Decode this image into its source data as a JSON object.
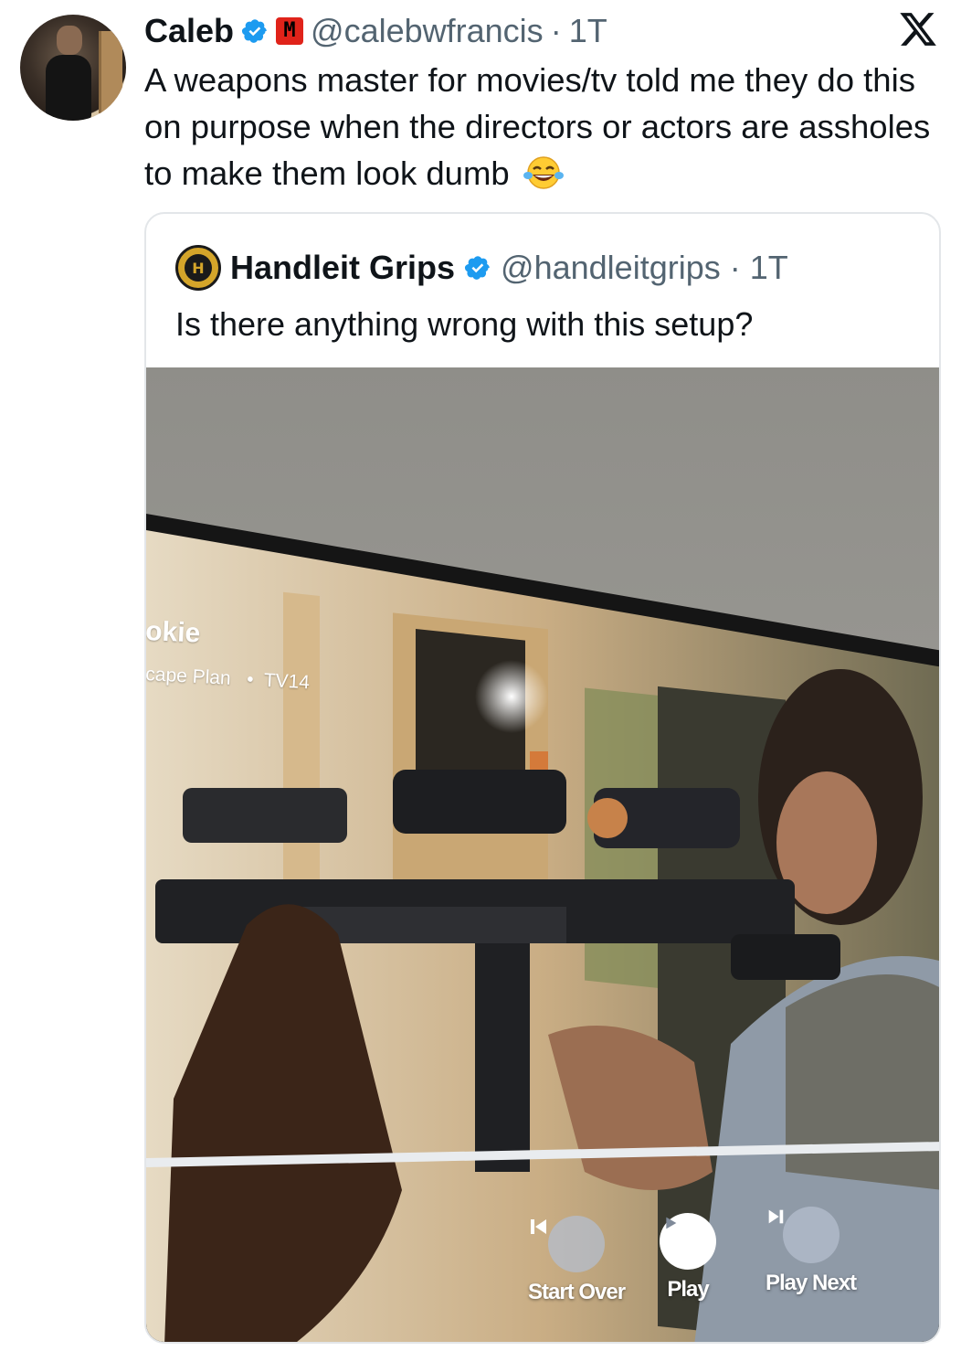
{
  "tweet": {
    "author_name": "Caleb",
    "author_handle": "@calebwfrancis",
    "separator": "·",
    "time": "1T",
    "text": "A weapons master for movies/tv told me they do this on purpose when the directors  or actors are assholes to make them look dumb",
    "emoji": "face-with-tears-of-joy",
    "brand_badge_text": "M"
  },
  "quoted_tweet": {
    "author_name": "Handleit Grips",
    "author_handle": "@handleitgrips",
    "separator": "·",
    "time": "1T",
    "text": "Is there anything wrong with this setup?",
    "avatar_text": "H"
  },
  "tv_screen": {
    "show_title": "okie",
    "show_subtitle": "cape Plan",
    "rating_dot": "•",
    "rating": "TV14",
    "controls": [
      {
        "label": "Start Over",
        "icon": "skip-back-icon"
      },
      {
        "label": "Play",
        "icon": "play-icon"
      },
      {
        "label": "Play Next",
        "icon": "skip-next-icon"
      }
    ]
  },
  "colors": {
    "verified": "#1d9bf0",
    "handle": "#536471",
    "text": "#0f1419",
    "border": "#e3e6e9",
    "brand_red": "#e0231a"
  }
}
